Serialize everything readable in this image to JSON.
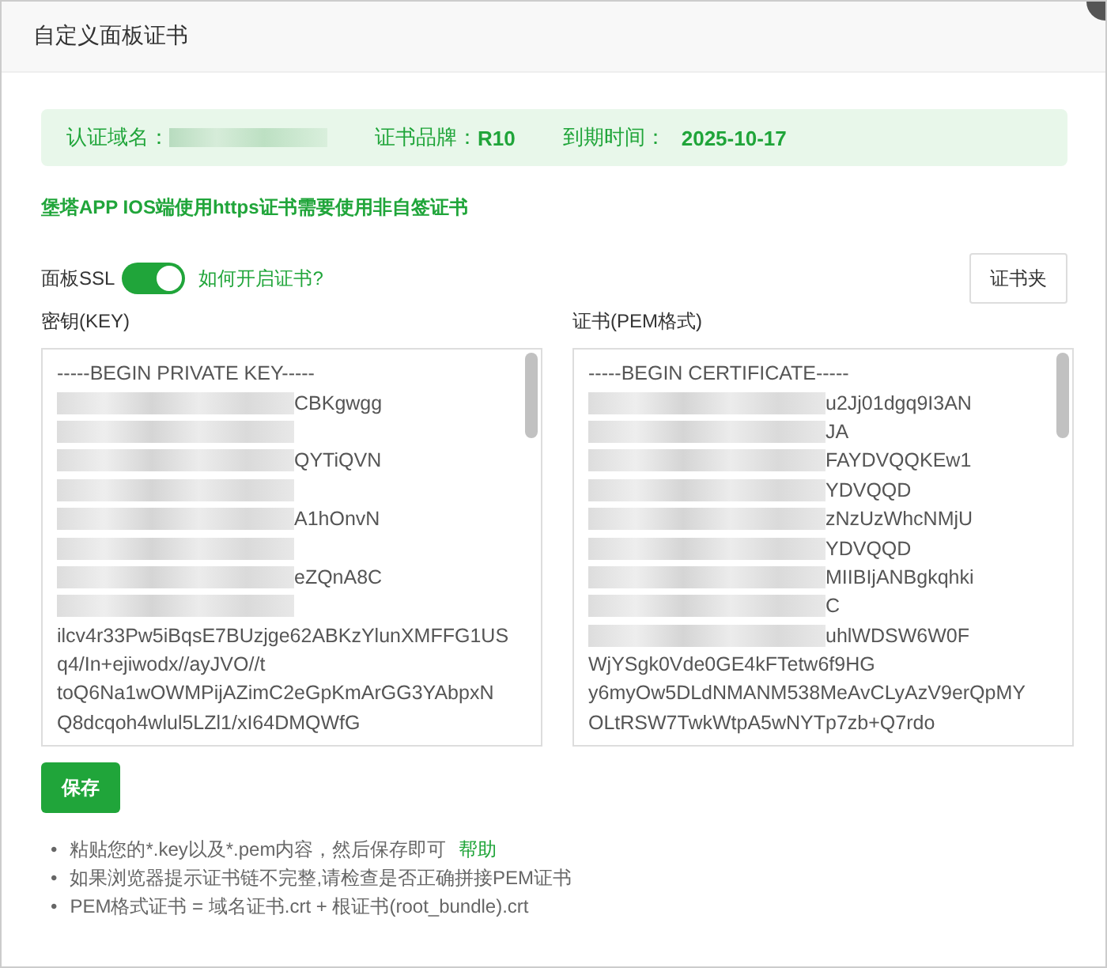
{
  "window": {
    "title": "自定义面板证书"
  },
  "info": {
    "domain_label": "认证域名：",
    "domain_blurred": true,
    "brand_label": "证书品牌：",
    "brand": "R10",
    "expiry_label": "到期时间：",
    "expiry": "2025-10-17"
  },
  "notice": "堡塔APP IOS端使用https证书需要使用非自签证书",
  "ssl": {
    "label": "面板SSL",
    "on": true,
    "help_link": "如何开启证书?",
    "folder_button": "证书夹"
  },
  "key": {
    "label": "密钥(KEY)",
    "lines": [
      {
        "text": "-----BEGIN PRIVATE KEY-----",
        "blur": false
      },
      {
        "text": "CBKgwgg",
        "blur": true
      },
      {
        "blur": true
      },
      {
        "text": "QYTiQVN",
        "blur": true
      },
      {
        "blur": true
      },
      {
        "text": "A1hOnvN",
        "blur": true
      },
      {
        "blur": true
      },
      {
        "text": "eZQnA8C",
        "blur": true
      },
      {
        "blur": true
      },
      {
        "text": "ilcv4r33Pw5iBqsE7BUzjge62ABKzYlunXMFFG1US",
        "blur": false
      },
      {
        "text": "q4/In+ejiwodx//ayJVO//t",
        "blur": false
      },
      {
        "text": "toQ6Na1wOWMPijAZimC2eGpKmArGG3YAbpxN",
        "blur": false
      },
      {
        "text": "Q8dcqoh4wlul5LZl1/xI64DMQWfG",
        "blur": false
      }
    ]
  },
  "cert": {
    "label": "证书(PEM格式)",
    "lines": [
      {
        "text": "-----BEGIN CERTIFICATE-----",
        "blur": false
      },
      {
        "text": "u2Jj01dgq9I3AN",
        "blur": true
      },
      {
        "text": "JA",
        "blur": true
      },
      {
        "text": "FAYDVQQKEw1",
        "blur": true
      },
      {
        "text": "YDVQQD",
        "blur": true
      },
      {
        "text": "zNzUzWhcNMjU",
        "blur": true
      },
      {
        "text": "YDVQQD",
        "blur": true
      },
      {
        "text": "MIIBIjANBgkqhki",
        "blur": true
      },
      {
        "text": "C",
        "blur": true
      },
      {
        "text": "uhlWDSW6W0F",
        "blur": true
      },
      {
        "text": "WjYSgk0Vde0GE4kFTetw6f9HG",
        "blur": false
      },
      {
        "text": "y6myOw5DLdNMANM538MeAvCLyAzV9erQpMY",
        "blur": false
      },
      {
        "text": "OLtRSW7TwkWtpA5wNYTp7zb+Q7rdo",
        "blur": false
      }
    ]
  },
  "save_button": "保存",
  "tips": [
    {
      "marker": "•",
      "text": "粘贴您的*.key以及*.pem内容，然后保存即可",
      "link": "帮助"
    },
    {
      "marker": "•",
      "text": "如果浏览器提示证书链不完整,请检查是否正确拼接PEM证书"
    },
    {
      "marker": "•",
      "text": "PEM格式证书 = 域名证书.crt + 根证书(root_bundle).crt"
    }
  ]
}
